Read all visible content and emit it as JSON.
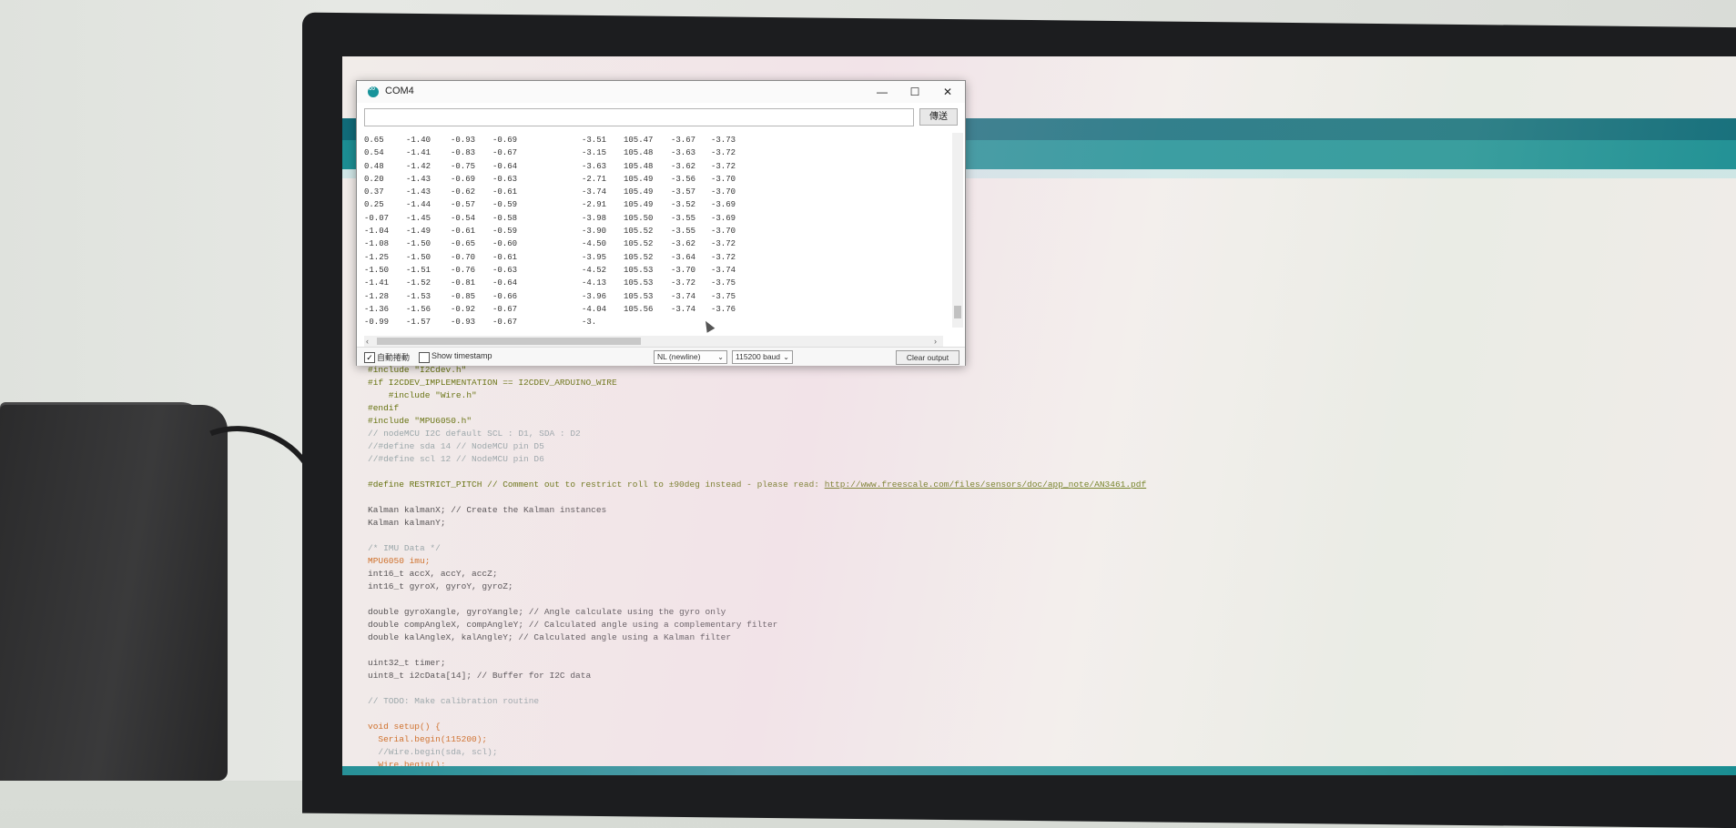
{
  "serial_monitor": {
    "title": "COM4",
    "window_controls": {
      "minimize": "—",
      "maximize": "☐",
      "close": "✕"
    },
    "input_value": "",
    "send_label": "傳送",
    "rows": [
      [
        "0.65",
        "-1.40",
        "-0.93",
        "-0.69",
        "-3.51",
        "105.47",
        "-3.67",
        "-3.73"
      ],
      [
        "0.54",
        "-1.41",
        "-0.83",
        "-0.67",
        "-3.15",
        "105.48",
        "-3.63",
        "-3.72"
      ],
      [
        "0.48",
        "-1.42",
        "-0.75",
        "-0.64",
        "-3.63",
        "105.48",
        "-3.62",
        "-3.72"
      ],
      [
        "0.20",
        "-1.43",
        "-0.69",
        "-0.63",
        "-2.71",
        "105.49",
        "-3.56",
        "-3.70"
      ],
      [
        "0.37",
        "-1.43",
        "-0.62",
        "-0.61",
        "-3.74",
        "105.49",
        "-3.57",
        "-3.70"
      ],
      [
        "0.25",
        "-1.44",
        "-0.57",
        "-0.59",
        "-2.91",
        "105.49",
        "-3.52",
        "-3.69"
      ],
      [
        "-0.07",
        "-1.45",
        "-0.54",
        "-0.58",
        "-3.98",
        "105.50",
        "-3.55",
        "-3.69"
      ],
      [
        "-1.04",
        "-1.49",
        "-0.61",
        "-0.59",
        "-3.90",
        "105.52",
        "-3.55",
        "-3.70"
      ],
      [
        "-1.08",
        "-1.50",
        "-0.65",
        "-0.60",
        "-4.50",
        "105.52",
        "-3.62",
        "-3.72"
      ],
      [
        "-1.25",
        "-1.50",
        "-0.70",
        "-0.61",
        "-3.95",
        "105.52",
        "-3.64",
        "-3.72"
      ],
      [
        "-1.50",
        "-1.51",
        "-0.76",
        "-0.63",
        "-4.52",
        "105.53",
        "-3.70",
        "-3.74"
      ],
      [
        "-1.41",
        "-1.52",
        "-0.81",
        "-0.64",
        "-4.13",
        "105.53",
        "-3.72",
        "-3.75"
      ],
      [
        "-1.28",
        "-1.53",
        "-0.85",
        "-0.66",
        "-3.96",
        "105.53",
        "-3.74",
        "-3.75"
      ],
      [
        "-1.36",
        "-1.56",
        "-0.92",
        "-0.67",
        "-4.04",
        "105.56",
        "-3.74",
        "-3.76"
      ],
      [
        "-0.99",
        "-1.57",
        "-0.93",
        "-0.67",
        "-3.",
        "",
        "",
        ""
      ]
    ],
    "autoscroll_label": "自動捲動",
    "autoscroll_checked": true,
    "timestamp_label": "Show timestamp",
    "timestamp_checked": false,
    "line_ending": "NL (newline)",
    "baud_rate": "115200 baud",
    "clear_label": "Clear output"
  },
  "code_lines": [
    {
      "text": "#include \"I2Cdev.h\"",
      "cls": "pp"
    },
    {
      "text": "#if I2CDEV_IMPLEMENTATION == I2CDEV_ARDUINO_WIRE",
      "cls": "pp"
    },
    {
      "text": "    #include \"Wire.h\"",
      "cls": "pp"
    },
    {
      "text": "#endif",
      "cls": "pp"
    },
    {
      "text": "#include \"MPU6050.h\"",
      "cls": "pp"
    },
    {
      "text": "// nodeMCU I2C default SCL : D1, SDA : D2",
      "cls": "cm"
    },
    {
      "text": "//#define sda 14 // NodeMCU pin D5",
      "cls": "cm"
    },
    {
      "text": "//#define scl 12 // NodeMCU pin D6",
      "cls": "cm"
    },
    {
      "text": "",
      "cls": "gap"
    },
    {
      "text": "#define RESTRICT_PITCH // Comment out to restrict roll to ±90deg instead - please read: ",
      "cls": "pp",
      "url": "http://www.freescale.com/files/sensors/doc/app_note/AN3461.pdf"
    },
    {
      "text": "",
      "cls": "gap"
    },
    {
      "text": "Kalman kalmanX; // Create the Kalman instances",
      "cls": ""
    },
    {
      "text": "Kalman kalmanY;",
      "cls": ""
    },
    {
      "text": "",
      "cls": "gap"
    },
    {
      "text": "/* IMU Data */",
      "cls": "cm"
    },
    {
      "text": "MPU6050 imu;",
      "cls": "ty"
    },
    {
      "text": "int16_t accX, accY, accZ;",
      "cls": ""
    },
    {
      "text": "int16_t gyroX, gyroY, gyroZ;",
      "cls": ""
    },
    {
      "text": "",
      "cls": "gap"
    },
    {
      "text": "double gyroXangle, gyroYangle; // Angle calculate using the gyro only",
      "cls": ""
    },
    {
      "text": "double compAngleX, compAngleY; // Calculated angle using a complementary filter",
      "cls": ""
    },
    {
      "text": "double kalAngleX, kalAngleY; // Calculated angle using a Kalman filter",
      "cls": ""
    },
    {
      "text": "",
      "cls": "gap"
    },
    {
      "text": "uint32_t timer;",
      "cls": ""
    },
    {
      "text": "uint8_t i2cData[14]; // Buffer for I2C data",
      "cls": ""
    },
    {
      "text": "",
      "cls": "gap"
    },
    {
      "text": "// TODO: Make calibration routine",
      "cls": "cm"
    },
    {
      "text": "",
      "cls": "gap"
    },
    {
      "text": "void setup() {",
      "cls": "ty"
    },
    {
      "text": "  Serial.begin(115200);",
      "cls": "ty"
    },
    {
      "text": "  //Wire.begin(sda, scl);",
      "cls": "cm"
    },
    {
      "text": "  Wire.begin();",
      "cls": "ty"
    }
  ]
}
